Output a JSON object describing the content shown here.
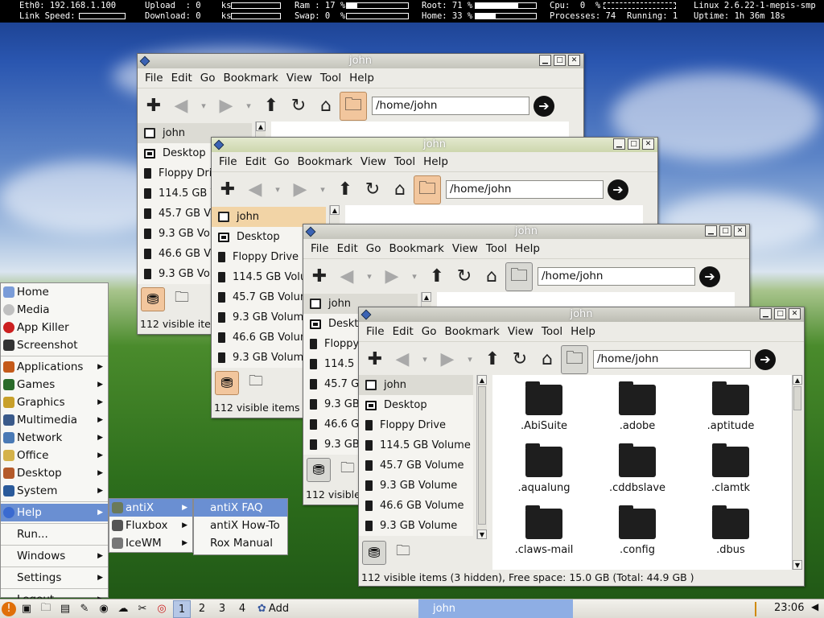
{
  "conky": {
    "eth0": "Eth0: 192.168.1.100",
    "link_speed": "Link Speed:",
    "upload": "Upload  : 0    ks",
    "download": "Download: 0    ks",
    "ram": "Ram : 17 %",
    "swap": "Swap: 0  %",
    "ram_pct": 17,
    "swap_pct": 0,
    "root": "Root: 71 %",
    "home": "Home: 33 %",
    "root_pct": 71,
    "home_pct": 33,
    "cpu": "Cpu:  0  %",
    "processes": "Processes: 74",
    "running": "Running: 1",
    "kernel": "Linux 2.6.22-1-mepis-smp",
    "uptime": "Uptime: 1h 36m 18s"
  },
  "windows": {
    "title": "john",
    "menus": [
      "File",
      "Edit",
      "Go",
      "Bookmark",
      "View",
      "Tool",
      "Help"
    ],
    "address": "/home/john",
    "sidebar": [
      "john",
      "Desktop",
      "Floppy Drive",
      "114.5 GB Volume",
      "45.7 GB Volume",
      "9.3 GB Volume",
      "46.6 GB Volume",
      "9.3 GB Volume"
    ],
    "status": "112 visible items (3 hidden), Free space: 15.0 GB (Total: 44.9 GB )",
    "status_short": "112 visible items",
    "files": [
      ".AbiSuite",
      ".adobe",
      ".aptitude",
      ".aqualung",
      ".cddbslave",
      ".clamtk",
      ".claws-mail",
      ".config",
      ".dbus"
    ]
  },
  "start_menu": {
    "items": [
      {
        "label": "Home",
        "icon": "home-icon",
        "color": "#7a9cd8"
      },
      {
        "label": "Media",
        "icon": "media-icon",
        "color": "#c0c0c0"
      },
      {
        "label": "App Killer",
        "icon": "app-killer-icon",
        "color": "#cc2020"
      },
      {
        "label": "Screenshot",
        "icon": "camera-icon",
        "color": "#333333"
      }
    ],
    "sub_items": [
      {
        "label": "Applications",
        "icon": "applications-icon",
        "color": "#c45a1a"
      },
      {
        "label": "Games",
        "icon": "games-icon",
        "color": "#2a6b2a"
      },
      {
        "label": "Graphics",
        "icon": "graphics-icon",
        "color": "#c8a02a"
      },
      {
        "label": "Multimedia",
        "icon": "multimedia-icon",
        "color": "#3a5a8a"
      },
      {
        "label": "Network",
        "icon": "network-icon",
        "color": "#4a7ab5"
      },
      {
        "label": "Office",
        "icon": "office-icon",
        "color": "#d4b24a"
      },
      {
        "label": "Desktop",
        "icon": "desktop-icon",
        "color": "#b45a2a"
      },
      {
        "label": "System",
        "icon": "system-icon",
        "color": "#2a5a9a"
      },
      {
        "label": "Help",
        "icon": "help-icon",
        "color": "#3a6ad0"
      }
    ],
    "bottom": [
      "Run...",
      "Windows",
      "Settings",
      "Logout..."
    ],
    "help_sub": [
      "antiX",
      "Fluxbox",
      "IceWM"
    ],
    "antix_sub": [
      "antiX FAQ",
      "antiX How-To",
      "Rox Manual"
    ]
  },
  "taskbar": {
    "workspaces": [
      "1",
      "2",
      "3",
      "4"
    ],
    "add": "Add",
    "task": "john",
    "clock": "23:06"
  }
}
